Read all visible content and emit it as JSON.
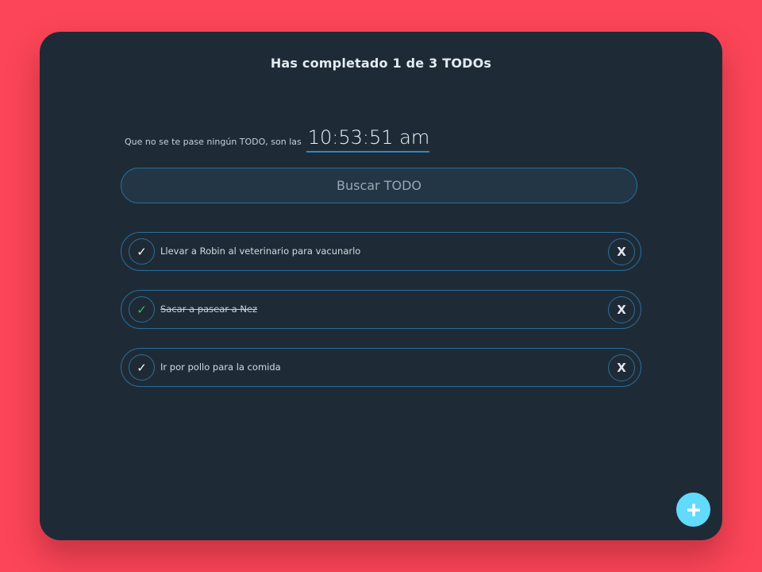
{
  "header": {
    "title": "Has completado 1 de 3 TODOs"
  },
  "clock": {
    "label": "Que no se te pase ningún TODO, son las",
    "time": "10:53:51 am"
  },
  "search": {
    "placeholder": "Buscar TODO",
    "value": ""
  },
  "todos": [
    {
      "text": "Llevar a Robin al veterinario para vacunarlo",
      "completed": false,
      "check_icon": "✓",
      "delete_label": "X"
    },
    {
      "text": "Sacar a pasear a Nez",
      "completed": true,
      "check_icon": "✓",
      "delete_label": "X"
    },
    {
      "text": "Ir por pollo para la comida",
      "completed": false,
      "check_icon": "✓",
      "delete_label": "X"
    }
  ],
  "fab": {
    "icon": "plus-icon"
  },
  "colors": {
    "page_background": "#fc4558",
    "card_background": "#1e2b36",
    "accent_border": "#2b6e9c",
    "completed_check": "#3cbd5b",
    "fab": "#61dafb"
  }
}
